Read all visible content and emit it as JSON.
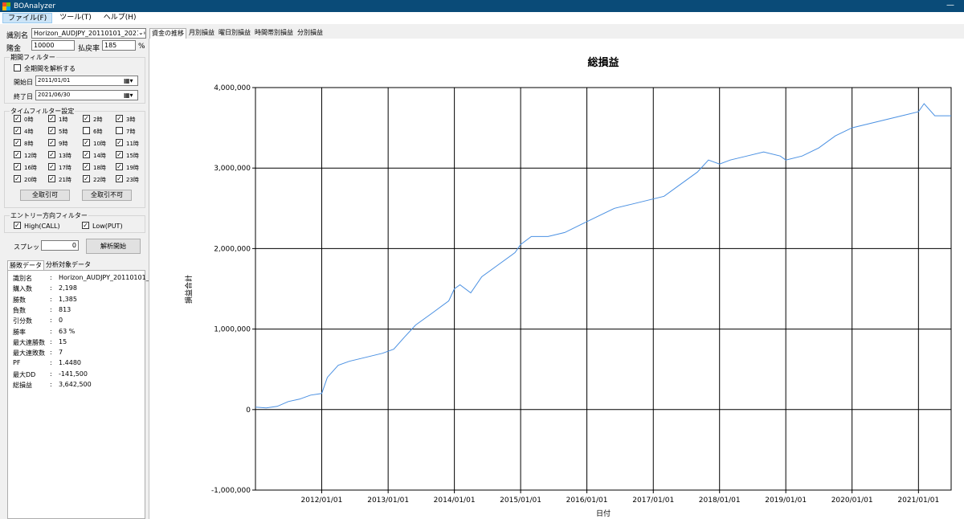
{
  "window": {
    "title": "BOAnalyzer",
    "minimize": "—"
  },
  "menu": [
    {
      "label": "ファイル(F)",
      "active": true
    },
    {
      "label": "ツール(T)",
      "active": false
    },
    {
      "label": "ヘルプ(H)",
      "active": false
    }
  ],
  "form": {
    "identifier_label": "識別名",
    "identifier_value": "Horizon_AUDJPY_20110101_20210630",
    "capital_label": "賭金",
    "capital_value": "10000",
    "payout_label": "払戻率",
    "payout_value": "185",
    "payout_unit": "%"
  },
  "period_filter": {
    "title": "期間フィルター",
    "all_label": "全期間を解析する",
    "all_checked": false,
    "start_label": "開始日",
    "start_value": "2011/01/01",
    "end_label": "終了日",
    "end_value": "2021/06/30"
  },
  "time_filter": {
    "title": "タイムフィルター設定",
    "hours": [
      {
        "label": "0時",
        "checked": true
      },
      {
        "label": "1時",
        "checked": true
      },
      {
        "label": "2時",
        "checked": true
      },
      {
        "label": "3時",
        "checked": true
      },
      {
        "label": "4時",
        "checked": true
      },
      {
        "label": "5時",
        "checked": true
      },
      {
        "label": "6時",
        "checked": false
      },
      {
        "label": "7時",
        "checked": false
      },
      {
        "label": "8時",
        "checked": true
      },
      {
        "label": "9時",
        "checked": true
      },
      {
        "label": "10時",
        "checked": true
      },
      {
        "label": "11時",
        "checked": true
      },
      {
        "label": "12時",
        "checked": true
      },
      {
        "label": "13時",
        "checked": true
      },
      {
        "label": "14時",
        "checked": true
      },
      {
        "label": "15時",
        "checked": true
      },
      {
        "label": "16時",
        "checked": true
      },
      {
        "label": "17時",
        "checked": true
      },
      {
        "label": "18時",
        "checked": true
      },
      {
        "label": "19時",
        "checked": true
      },
      {
        "label": "20時",
        "checked": true
      },
      {
        "label": "21時",
        "checked": true
      },
      {
        "label": "22時",
        "checked": true
      },
      {
        "label": "23時",
        "checked": true
      }
    ],
    "allow_all": "全取引可",
    "deny_all": "全取引不可"
  },
  "entry_filter": {
    "title": "エントリー方向フィルター",
    "high_label": "High(CALL)",
    "high_checked": true,
    "low_label": "Low(PUT)",
    "low_checked": true
  },
  "spread": {
    "label": "スプレッド",
    "value": "0"
  },
  "analyze_button": "解析開始",
  "left_tabs": [
    "勝敗データ",
    "分析対象データ"
  ],
  "stats": [
    {
      "label": "識別名",
      "value": "Horizon_AUDJPY_20110101_202"
    },
    {
      "label": "購入数",
      "value": "2,198"
    },
    {
      "label": "勝数",
      "value": "1,385"
    },
    {
      "label": "負数",
      "value": "813"
    },
    {
      "label": "引分数",
      "value": "0"
    },
    {
      "label": "勝率",
      "value": "63 %"
    },
    {
      "label": "最大連勝数",
      "value": "15"
    },
    {
      "label": "最大連敗数",
      "value": "7"
    },
    {
      "label": "PF",
      "value": "1.4480"
    },
    {
      "label": "最大DD",
      "value": "-141,500"
    },
    {
      "label": "総損益",
      "value": "3,642,500"
    }
  ],
  "right_tabs": [
    {
      "label": "資金の推移",
      "active": true
    },
    {
      "label": "月別損益",
      "active": false
    },
    {
      "label": "曜日別損益",
      "active": false
    },
    {
      "label": "時間帯別損益",
      "active": false
    },
    {
      "label": "分別損益",
      "active": false
    }
  ],
  "colors": {
    "titlebar": "#0a4b78",
    "line": "#4a90e2"
  },
  "chart_data": {
    "type": "line",
    "title": "総損益",
    "xlabel": "日付",
    "ylabel": "損益合計",
    "ylim": [
      -1000000,
      4000000
    ],
    "xlim": [
      "2011/01/01",
      "2021/06/30"
    ],
    "yticks": [
      -1000000,
      0,
      1000000,
      2000000,
      3000000,
      4000000
    ],
    "ytick_labels": [
      "-1,000,000",
      "0",
      "1,000,000",
      "2,000,000",
      "3,000,000",
      "4,000,000"
    ],
    "xticks": [
      "2012/01/01",
      "2013/01/01",
      "2014/01/01",
      "2015/01/01",
      "2016/01/01",
      "2017/01/01",
      "2018/01/01",
      "2019/01/01",
      "2020/01/01",
      "2021/01/01"
    ],
    "grid": true,
    "series": [
      {
        "x": [
          "2011/01/01",
          "2011/03/01",
          "2011/05/01",
          "2011/07/01",
          "2011/09/01",
          "2011/11/01",
          "2012/01/01",
          "2012/02/01",
          "2012/04/01",
          "2012/06/01",
          "2012/09/01",
          "2012/12/01",
          "2013/02/01",
          "2013/04/01",
          "2013/06/01",
          "2013/09/01",
          "2013/12/01",
          "2014/01/01",
          "2014/02/01",
          "2014/04/01",
          "2014/06/01",
          "2014/09/01",
          "2014/12/01",
          "2015/01/01",
          "2015/03/01",
          "2015/06/01",
          "2015/09/01",
          "2015/12/01",
          "2016/03/01",
          "2016/06/01",
          "2016/09/01",
          "2016/12/01",
          "2017/03/01",
          "2017/06/01",
          "2017/09/01",
          "2017/11/01",
          "2018/01/01",
          "2018/03/01",
          "2018/06/01",
          "2018/09/01",
          "2018/12/01",
          "2019/01/01",
          "2019/04/01",
          "2019/07/01",
          "2019/10/01",
          "2020/01/01",
          "2020/04/01",
          "2020/07/01",
          "2020/10/01",
          "2021/01/01",
          "2021/02/01",
          "2021/04/01",
          "2021/06/30"
        ],
        "y": [
          30000,
          20000,
          40000,
          100000,
          130000,
          180000,
          200000,
          400000,
          550000,
          600000,
          650000,
          700000,
          750000,
          900000,
          1050000,
          1200000,
          1350000,
          1500000,
          1550000,
          1450000,
          1650000,
          1800000,
          1950000,
          2050000,
          2150000,
          2150000,
          2200000,
          2300000,
          2400000,
          2500000,
          2550000,
          2600000,
          2650000,
          2800000,
          2950000,
          3100000,
          3050000,
          3100000,
          3150000,
          3200000,
          3150000,
          3100000,
          3150000,
          3250000,
          3400000,
          3500000,
          3550000,
          3600000,
          3650000,
          3700000,
          3800000,
          3650000,
          3650000
        ]
      }
    ]
  }
}
